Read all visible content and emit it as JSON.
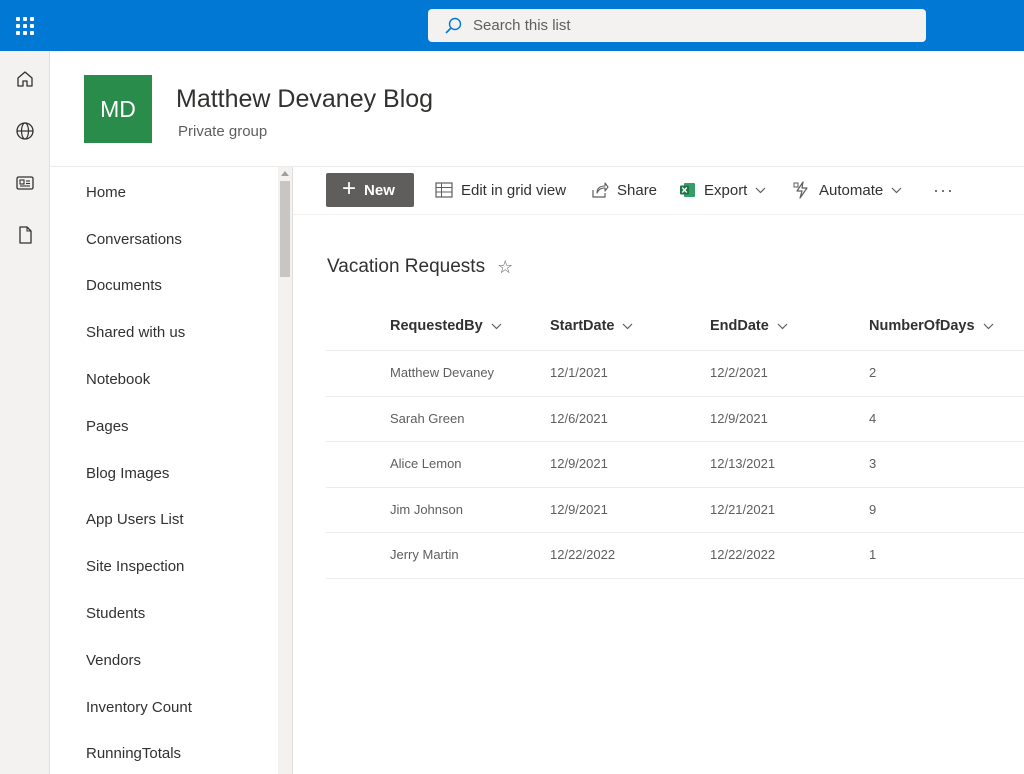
{
  "search": {
    "placeholder": "Search this list"
  },
  "site": {
    "logo_initials": "MD",
    "title": "Matthew Devaney Blog",
    "subtitle": "Private group",
    "logo_color": "#2a8c4a"
  },
  "rail": [
    {
      "icon": "home-icon"
    },
    {
      "icon": "globe-icon"
    },
    {
      "icon": "news-icon"
    },
    {
      "icon": "file-icon"
    }
  ],
  "nav": {
    "items": [
      {
        "label": "Home"
      },
      {
        "label": "Conversations"
      },
      {
        "label": "Documents"
      },
      {
        "label": "Shared with us"
      },
      {
        "label": "Notebook"
      },
      {
        "label": "Pages"
      },
      {
        "label": "Blog Images"
      },
      {
        "label": "App Users List"
      },
      {
        "label": "Site Inspection"
      },
      {
        "label": "Students"
      },
      {
        "label": "Vendors"
      },
      {
        "label": "Inventory Count"
      },
      {
        "label": "RunningTotals"
      }
    ]
  },
  "commands": {
    "new_label": "New",
    "grid_label": "Edit in grid view",
    "share_label": "Share",
    "export_label": "Export",
    "automate_label": "Automate",
    "more_label": "···"
  },
  "list": {
    "title": "Vacation Requests",
    "columns": [
      "RequestedBy",
      "StartDate",
      "EndDate",
      "NumberOfDays"
    ],
    "rows": [
      [
        "Matthew Devaney",
        "12/1/2021",
        "12/2/2021",
        "2"
      ],
      [
        "Sarah Green",
        "12/6/2021",
        "12/9/2021",
        "4"
      ],
      [
        "Alice Lemon",
        "12/9/2021",
        "12/13/2021",
        "3"
      ],
      [
        "Jim Johnson",
        "12/9/2021",
        "12/21/2021",
        "9"
      ],
      [
        "Jerry Martin",
        "12/22/2022",
        "12/22/2022",
        "1"
      ]
    ]
  },
  "colors": {
    "suite_bar": "#0078d4",
    "new_button": "#605e5c",
    "excel_green": "#217346"
  }
}
